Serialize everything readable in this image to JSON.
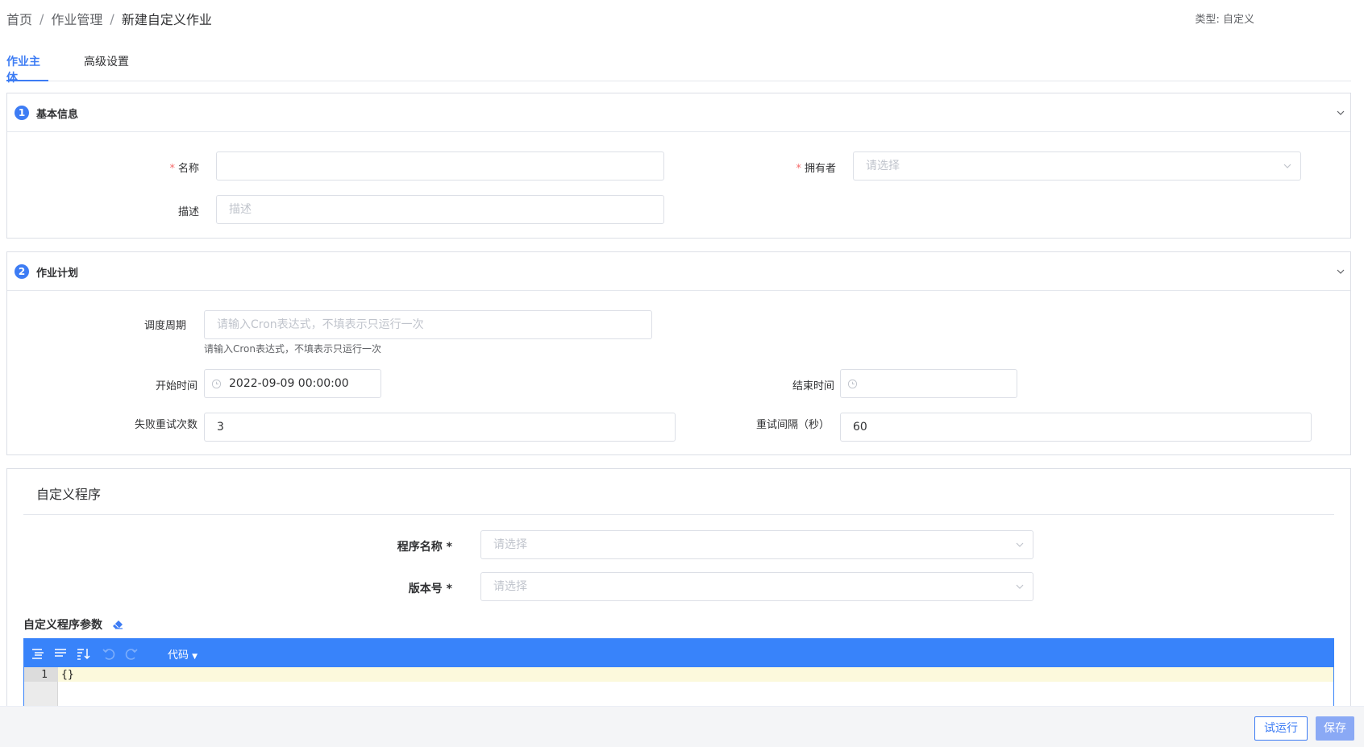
{
  "breadcrumb": {
    "items": [
      "首页",
      "作业管理",
      "新建自定义作业"
    ],
    "separator": "/"
  },
  "type_label": "类型: 自定义",
  "tabs": [
    "作业主体",
    "高级设置"
  ],
  "basic_info": {
    "step": "1",
    "title": "基本信息",
    "name_label": "名称",
    "name_value": "",
    "owner_label": "拥有者",
    "owner_placeholder": "请选择",
    "desc_label": "描述",
    "desc_placeholder": "描述"
  },
  "schedule": {
    "step": "2",
    "title": "作业计划",
    "cron_label": "调度周期",
    "cron_placeholder": "请输入Cron表达式，不填表示只运行一次",
    "cron_hint": "请输入Cron表达式，不填表示只运行一次",
    "start_label": "开始时间",
    "start_value": "2022-09-09 00:00:00",
    "end_label": "结束时间",
    "end_value": "",
    "retry_count_label": "失败重试次数",
    "retry_count_value": "3",
    "retry_interval_label": "重试间隔（秒）",
    "retry_interval_value": "60"
  },
  "program": {
    "title": "自定义程序",
    "program_name_label": "程序名称 *",
    "program_name_placeholder": "请选择",
    "version_label": "版本号 *",
    "version_placeholder": "请选择",
    "params_label": "自定义程序参数",
    "editor_mode": "代码",
    "line_number": "1",
    "code": "{}"
  },
  "footer": {
    "trial_run_label": "试运行",
    "save_label": "保存"
  },
  "colors": {
    "accent": "#3d7cf4",
    "editor_toolbar": "#3883fa",
    "required": "#f56c6c",
    "save_disabled": "#8aa9f5"
  }
}
